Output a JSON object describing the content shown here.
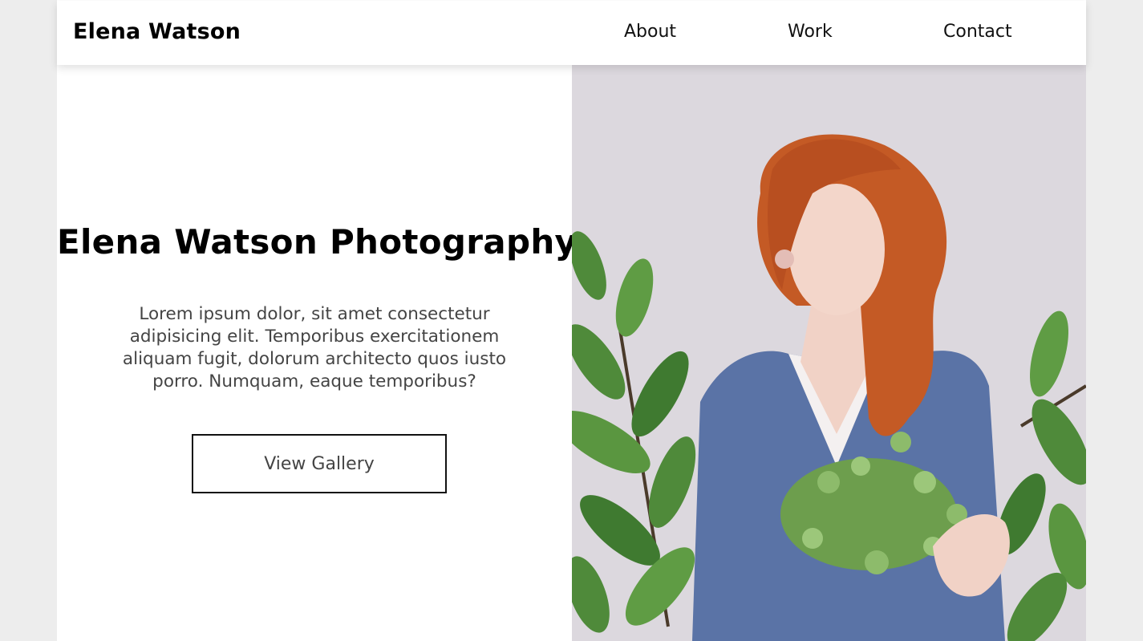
{
  "header": {
    "brand": "Elena Watson",
    "nav": [
      {
        "label": "About"
      },
      {
        "label": "Work"
      },
      {
        "label": "Contact"
      }
    ]
  },
  "hero": {
    "title": "Elena Watson Photography",
    "description": "Lorem ipsum dolor, sit amet consectetur adipisicing elit. Temporibus exercitationem aliquam fugit, dolorum architecto quos iusto porro. Numquam, eaque temporibus?",
    "cta_label": "View Gallery"
  },
  "colors": {
    "page_background": "#ededed",
    "photo_background": "#dcd8de",
    "sweater": "#5a73a6",
    "hair": "#c45a25",
    "foliage": "#4f8a3a"
  }
}
